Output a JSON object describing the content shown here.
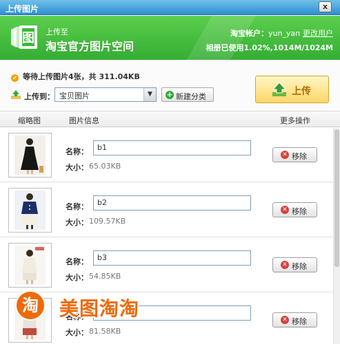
{
  "window": {
    "title": "上传图片",
    "close_label": "x"
  },
  "banner": {
    "upload_to": "上传至",
    "space_name": "淘宝官方图片空间",
    "account_label": "淘宝帐户：",
    "account_name": "yun_yan",
    "change_user": "更改用户",
    "usage": "相册已使用1.02%,1014M/1024M"
  },
  "summary": {
    "wait_text": "等待上传图片4张，共 311.04KB",
    "dest_label": "上传到：",
    "dest_value": "宝贝图片",
    "new_category": "新建分类",
    "upload_button": "上传"
  },
  "columns": {
    "thumb": "缩略图",
    "info": "图片信息",
    "more": "更多操作"
  },
  "labels": {
    "name": "名称：",
    "size": "大小：",
    "remove": "移除"
  },
  "items": [
    {
      "name": "b1",
      "size": "65.03KB"
    },
    {
      "name": "b2",
      "size": "109.57KB"
    },
    {
      "name": "b3",
      "size": "54.85KB"
    },
    {
      "name": "",
      "size": "81.58KB"
    }
  ],
  "watermark": {
    "logo_char": "淘",
    "text": "美图淘淘"
  },
  "colors": {
    "banner_green": "#3db83a",
    "title_blue": "#2e8fd0",
    "upload_orange": "#b06c00",
    "remove_red": "#d8403a"
  }
}
